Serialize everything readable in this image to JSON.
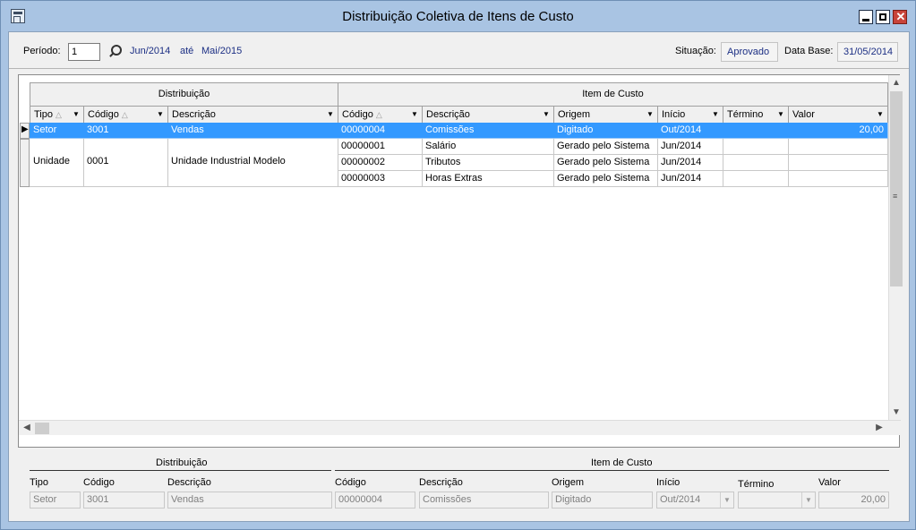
{
  "window": {
    "title": "Distribuição Coletiva de Itens de Custo"
  },
  "filter": {
    "periodo_label": "Período:",
    "periodo_value": "1",
    "inicio": "Jun/2014",
    "ate_label": "até",
    "fim": "Mai/2015",
    "situacao_label": "Situação:",
    "situacao_value": "Aprovado",
    "data_base_label": "Data Base:",
    "data_base_value": "31/05/2014"
  },
  "grid": {
    "band_distribuicao": "Distribuição",
    "band_item": "Item de Custo",
    "columns": [
      "Tipo",
      "Código",
      "Descrição",
      "Código",
      "Descrição",
      "Origem",
      "Início",
      "Término",
      "Valor"
    ],
    "groups": [
      {
        "tipo": "Setor",
        "codigo": "3001",
        "descricao": "Vendas"
      },
      {
        "tipo": "Unidade",
        "codigo": "0001",
        "descricao": "Unidade Industrial Modelo"
      }
    ],
    "items": [
      {
        "codigo": "00000004",
        "descricao": "Comissões",
        "origem": "Digitado",
        "inicio": "Out/2014",
        "termino": "",
        "valor": "20,00"
      },
      {
        "codigo": "00000001",
        "descricao": "Salário",
        "origem": "Gerado pelo Sistema",
        "inicio": "Jun/2014",
        "termino": "",
        "valor": ""
      },
      {
        "codigo": "00000002",
        "descricao": "Tributos",
        "origem": "Gerado pelo Sistema",
        "inicio": "Jun/2014",
        "termino": "",
        "valor": ""
      },
      {
        "codigo": "00000003",
        "descricao": "Horas Extras",
        "origem": "Gerado pelo Sistema",
        "inicio": "Jun/2014",
        "termino": "",
        "valor": ""
      }
    ]
  },
  "detail": {
    "band_distribuicao": "Distribuição",
    "band_item": "Item de Custo",
    "labels": {
      "tipo": "Tipo",
      "codigo": "Código",
      "descricao": "Descrição",
      "codigo_item": "Código",
      "descricao_item": "Descrição",
      "origem": "Origem",
      "inicio": "Início",
      "termino": "Término",
      "valor": "Valor"
    },
    "values": {
      "tipo": "Setor",
      "codigo": "3001",
      "descricao": "Vendas",
      "codigo_item": "00000004",
      "descricao_item": "Comissões",
      "origem": "Digitado",
      "inicio": "Out/2014",
      "termino": "",
      "valor": "20,00"
    }
  },
  "colors": {
    "selection": "#3399ff",
    "title_bar": "#a9c4e3",
    "link_blue": "#1c2f84"
  }
}
